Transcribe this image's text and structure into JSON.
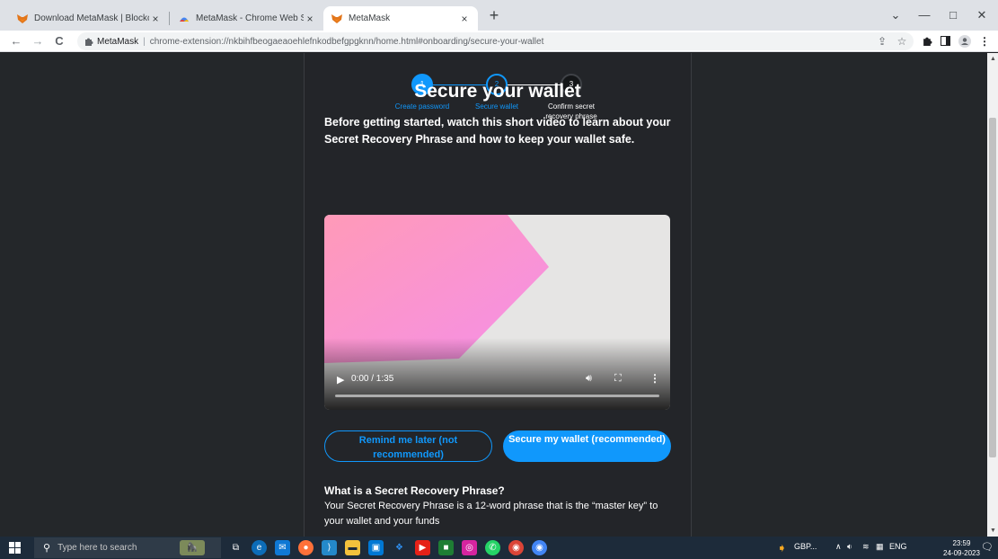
{
  "browser": {
    "tabs": [
      {
        "title": "Download MetaMask | Blockchai",
        "active": false,
        "icon": "metamask-fox-icon"
      },
      {
        "title": "MetaMask - Chrome Web Store",
        "active": false,
        "icon": "chrome-web-store-icon"
      },
      {
        "title": "MetaMask",
        "active": true,
        "icon": "metamask-fox-icon"
      }
    ],
    "tab_close_glyph": "×",
    "new_tab_glyph": "+",
    "window_controls": {
      "dropdown": "⌄",
      "minimize": "—",
      "maximize": "□",
      "close": "✕"
    },
    "address": {
      "site_name": "MetaMask",
      "url": "chrome-extension://nkbihfbeogaeaoehlefnkodbefgpgknn/home.html#onboarding/secure-your-wallet"
    },
    "nav": {
      "back": "←",
      "forward": "→",
      "reload": "C"
    }
  },
  "stepper": {
    "steps": [
      {
        "number": "1",
        "label": "Create password",
        "state": "done"
      },
      {
        "number": "2",
        "label": "Secure wallet",
        "state": "current"
      },
      {
        "number": "3",
        "label": "Confirm secret recovery phrase",
        "state": "todo"
      }
    ]
  },
  "page": {
    "title": "Secure your wallet",
    "intro": "Before getting started, watch this short video to learn about your Secret Recovery Phrase and how to keep your wallet safe.",
    "video": {
      "time": "0:00 / 1:35",
      "progress": 0
    },
    "buttons": {
      "remind_later": "Remind me later (not recommended)",
      "secure_wallet": "Secure my wallet (recommended)"
    },
    "faq": {
      "question": "What is a Secret Recovery Phrase?",
      "answer": "Your Secret Recovery Phrase is a 12-word phrase that is the “master key” to your wallet and your funds"
    }
  },
  "colors": {
    "accent": "#1098fc",
    "page_bg": "#24272a",
    "taskbar_bg": "#1d2b3a"
  },
  "taskbar": {
    "search_placeholder": "Type here to search",
    "tray_currency": "GBP...",
    "tray_language": "ENG",
    "time": "23:59",
    "date": "24-09-2023"
  }
}
